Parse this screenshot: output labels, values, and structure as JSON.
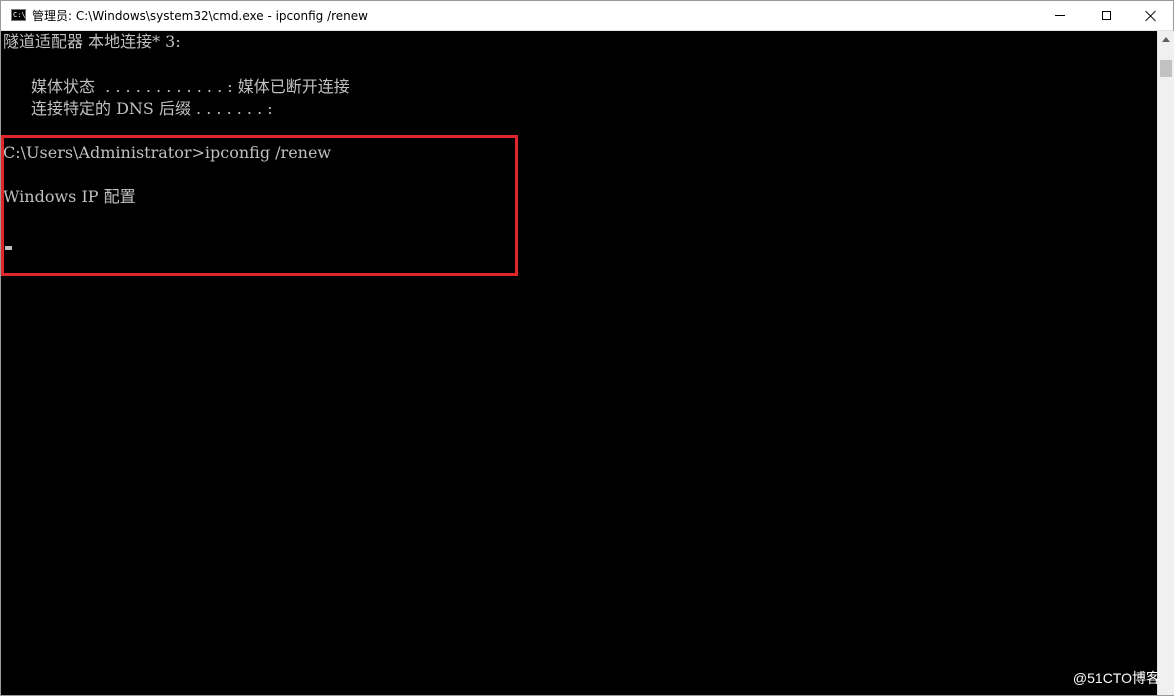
{
  "window": {
    "title": "管理员: C:\\Windows\\system32\\cmd.exe - ipconfig  /renew",
    "icon": "cmd-icon",
    "controls": {
      "minimize": "minimize-icon",
      "maximize": "maximize-icon",
      "close": "close-icon"
    }
  },
  "console": {
    "lines": [
      "隧道适配器 本地连接* 3:",
      "媒体状态  . . . . . . . . . . . . : 媒体已断开连接",
      "连接特定的 DNS 后缀 . . . . . . . :",
      "C:\\Users\\Administrator>ipconfig /renew",
      "Windows IP 配置"
    ]
  },
  "highlight": {
    "color": "#e0262b"
  },
  "watermark": "@51CTO博客"
}
